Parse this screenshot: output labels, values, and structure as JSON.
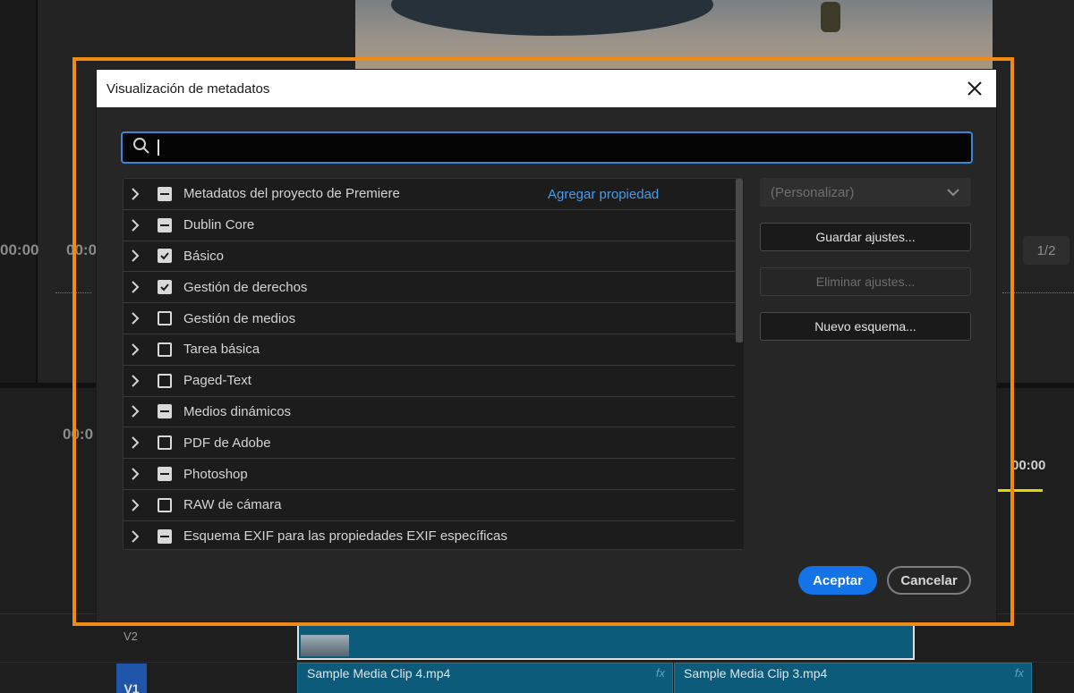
{
  "dialog": {
    "title": "Visualización de metadatos",
    "search": {
      "value": "",
      "placeholder": ""
    },
    "add_property_label": "Agregar propiedad",
    "schemas": [
      {
        "label": "Metadatos del proyecto de Premiere",
        "state": "mixed"
      },
      {
        "label": "Dublin Core",
        "state": "mixed"
      },
      {
        "label": "Básico",
        "state": "checked"
      },
      {
        "label": "Gestión de derechos",
        "state": "checked"
      },
      {
        "label": "Gestión de medios",
        "state": "unchecked"
      },
      {
        "label": " Tarea básica",
        "state": "unchecked"
      },
      {
        "label": "Paged-Text",
        "state": "unchecked"
      },
      {
        "label": "Medios dinámicos",
        "state": "mixed"
      },
      {
        "label": "PDF de Adobe",
        "state": "unchecked"
      },
      {
        "label": "Photoshop",
        "state": "mixed"
      },
      {
        "label": "RAW de cámara",
        "state": "unchecked"
      },
      {
        "label": "Esquema EXIF para las propiedades EXIF específicas",
        "state": "mixed"
      }
    ],
    "preset_select": "(Personalizar)",
    "save_settings": "Guardar ajustes...",
    "delete_settings": "Eliminar ajustes...",
    "new_schema": "Nuevo esquema...",
    "ok": "Aceptar",
    "cancel": "Cancelar"
  },
  "background": {
    "timecode_left": "00:00",
    "timecode_left2": "00:0",
    "timecode_tl": "00:0",
    "timecode_right": "00:00",
    "page_indicator": "1/2",
    "track_v2": "V2",
    "track_v1": "V1",
    "clip_v2_name": "Sample Media Clip 4.mp4",
    "clip_a_name": "Sample Media Clip 4.mp4",
    "clip_b_name": "Sample Media Clip 3.mp4",
    "fx": "fx"
  },
  "colors": {
    "highlight": "#f08a12",
    "accent": "#1473e6",
    "link": "#4a9ce8",
    "clip": "#0d5b7a"
  }
}
